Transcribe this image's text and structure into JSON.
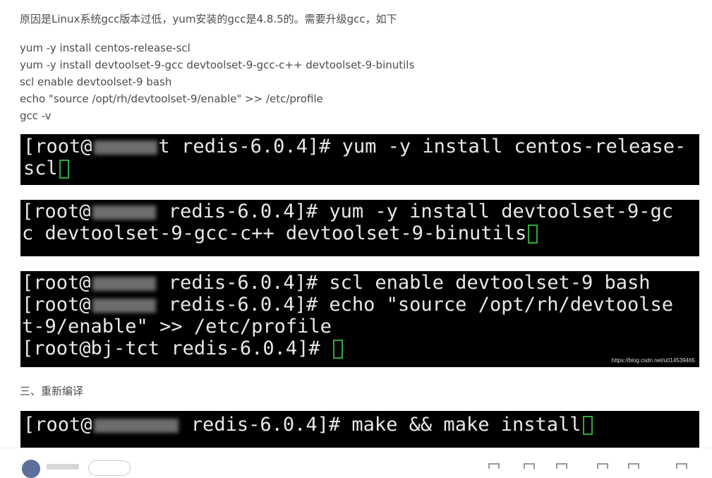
{
  "intro_text": "原因是Linux系统gcc版本过低，yum安装的gcc是4.8.5的。需要升级gcc，如下",
  "commands": [
    "yum -y install centos-release-scl",
    "yum -y install devtoolset-9-gcc devtoolset-9-gcc-c++ devtoolset-9-binutils",
    "scl enable devtoolset-9 bash",
    "echo \"source /opt/rh/devtoolset-9/enable\" >> /etc/profile",
    "gcc -v"
  ],
  "terminal1": {
    "prompt_start": "[root@",
    "prompt_end": "t redis-6.0.4]# ",
    "line1_rest": "yum -y install centos-release-",
    "line2": "scl"
  },
  "terminal2": {
    "prompt_start": "[root@",
    "prompt_end": " redis-6.0.4]# ",
    "line1_rest": "yum -y install devtoolset-9-gc",
    "line2": "c devtoolset-9-gcc-c++ devtoolset-9-binutils"
  },
  "terminal3": {
    "line1_start": "[root@",
    "line1_end": " redis-6.0.4]# scl enable devtoolset-9 bash",
    "line2_start": "[root@",
    "line2_end": " redis-6.0.4]# echo \"source /opt/rh/devtoolse",
    "line3": "t-9/enable\" >> /etc/profile",
    "line4": "[root@bj-tct redis-6.0.4]# ",
    "watermark": "https://blog.csdn.net/u014539465"
  },
  "section_heading": "三、重新编译",
  "terminal4": {
    "prompt_start": "[root@",
    "prompt_end": " redis-6.0.4]# ",
    "line1_rest": "make && make install"
  },
  "colors": {
    "terminal_bg": "#000000",
    "terminal_text": "#e8e8e8",
    "cursor": "#2faa3b",
    "body_text": "#4d4d4d"
  },
  "icons": [
    "avatar",
    "follow-button",
    "like-icon",
    "comment-icon",
    "collect-icon",
    "share-icon"
  ]
}
